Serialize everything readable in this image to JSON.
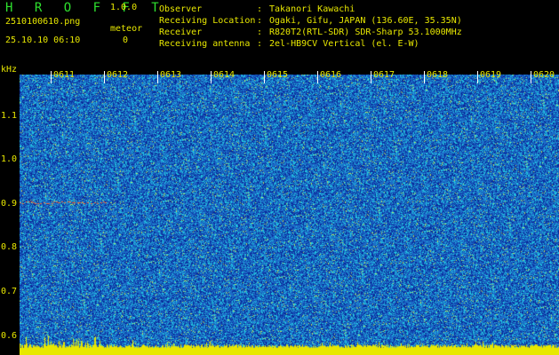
{
  "header": {
    "app_title": "H R O F F T",
    "app_version": "1.0.0",
    "file_name": "2510100610.png",
    "timestamp": "25.10.10 06:10",
    "meteor_label": "meteor",
    "meteor_count": "0"
  },
  "info": [
    {
      "key": "Observer",
      "value": "Takanori Kawachi"
    },
    {
      "key": "Receiving Location",
      "value": "Ogaki, Gifu, JAPAN (136.60E, 35.35N)"
    },
    {
      "key": "Receiver",
      "value": "R820T2(RTL-SDR) SDR-Sharp 53.1000MHz"
    },
    {
      "key": "Receiving antenna",
      "value": "2el-HB9CV Vertical (el. E-W)"
    }
  ],
  "spectrogram": {
    "y_unit": "kHz",
    "y_ticks": [
      "1.1",
      "1.0",
      "0.9",
      "0.8",
      "0.7",
      "0.6"
    ],
    "x_ticks": [
      "0611",
      "0612",
      "0613",
      "0614",
      "0615",
      "0616",
      "0617",
      "0618",
      "0619",
      "0620"
    ],
    "colors": {
      "background": "#1c6cc8",
      "noise_low": "#0a2a9a",
      "noise_high": "#22c8e0",
      "speck": "#b8e860",
      "floor": "#e8e800",
      "label": "#e8e800"
    }
  }
}
